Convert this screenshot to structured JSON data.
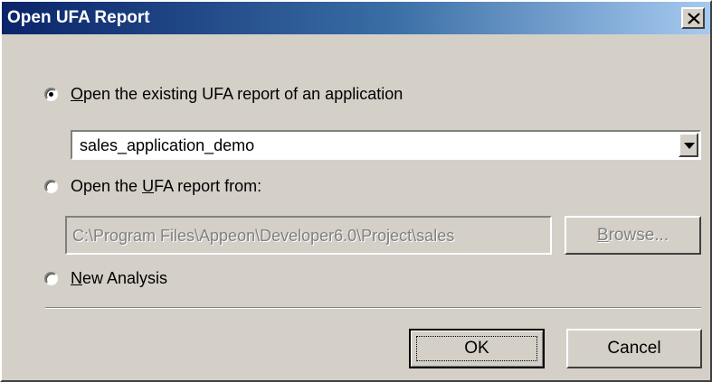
{
  "window": {
    "title": "Open UFA Report",
    "close_symbol": "×"
  },
  "option_existing": {
    "label_prefix": "",
    "label_accel": "O",
    "label_rest": "pen the existing UFA report of an application",
    "checked": true
  },
  "application_combo": {
    "value": "sales_application_demo"
  },
  "option_from": {
    "label_prefix": "Open the ",
    "label_accel": "U",
    "label_rest": "FA report from:",
    "checked": false
  },
  "path_field": {
    "value": "C:\\Program Files\\Appeon\\Developer6.0\\Project\\sales"
  },
  "browse_button": {
    "label_accel": "B",
    "label_rest": "rowse..."
  },
  "option_new": {
    "label_prefix": "",
    "label_accel": "N",
    "label_rest": "ew Analysis",
    "checked": false
  },
  "ok_button": {
    "label": "OK"
  },
  "cancel_button": {
    "label": "Cancel"
  }
}
